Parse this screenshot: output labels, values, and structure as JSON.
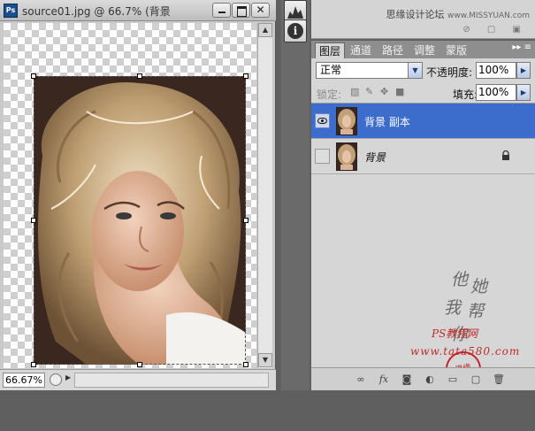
{
  "document": {
    "title": "source01.jpg @ 66.7% (背景",
    "app_badge": "Ps",
    "close_glyph": "✕",
    "zoom": "66.67%"
  },
  "top_panel": {
    "watermark_cn": "思缘设计论坛",
    "watermark_en": "www.MISSYUAN.com"
  },
  "layers_panel": {
    "tabs": [
      {
        "label": "图层",
        "active": true
      },
      {
        "label": "通道",
        "active": false
      },
      {
        "label": "路径",
        "active": false
      },
      {
        "label": "调整",
        "active": false
      },
      {
        "label": "蒙版",
        "active": false
      }
    ],
    "menu_glyph": "▸▸ ≡",
    "blend_mode": "正常",
    "opacity_label": "不透明度:",
    "opacity_value": "100%",
    "lock_label": "锁定:",
    "fill_label": "填充:",
    "fill_value": "100%",
    "layers": [
      {
        "name": "背景 副本",
        "selected": true,
        "visible": true,
        "locked": false
      },
      {
        "name": "背景",
        "selected": false,
        "visible": false,
        "locked": true
      }
    ],
    "signature_chars": [
      "他",
      "她",
      "我",
      "帮",
      "你"
    ],
    "seal_text": "思缘",
    "watermark_ps": "PS教程网",
    "watermark_site": "www.tata580.com",
    "bottom_fx": "fx"
  },
  "colors": {
    "selected_row": "#3c6ccc",
    "watermark_red": "#bf2a2a"
  }
}
